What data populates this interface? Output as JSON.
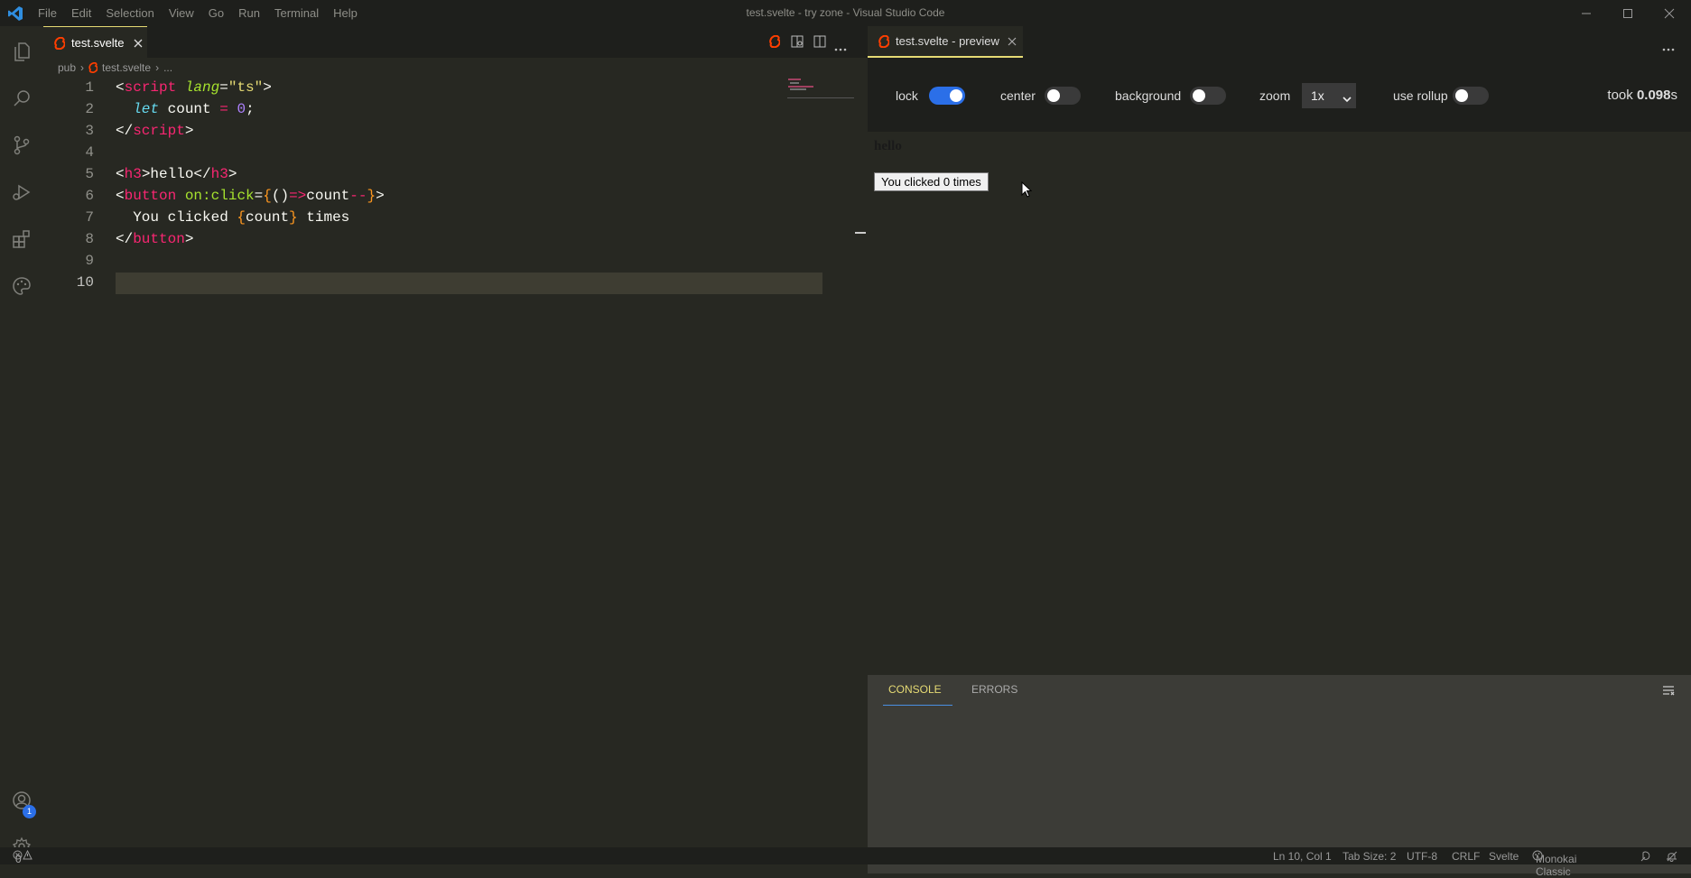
{
  "window": {
    "title": "test.svelte - try zone - Visual Studio Code"
  },
  "menu": [
    "File",
    "Edit",
    "Selection",
    "View",
    "Go",
    "Run",
    "Terminal",
    "Help"
  ],
  "editor": {
    "tab_label": "test.svelte",
    "breadcrumb": {
      "folder": "pub",
      "file": "test.svelte",
      "more": "..."
    },
    "line_numbers": [
      "1",
      "2",
      "3",
      "4",
      "5",
      "6",
      "7",
      "8",
      "9",
      "10"
    ],
    "code": {
      "l1": {
        "a": "<",
        "b": "script",
        "c": " ",
        "d": "lang",
        "e": "=",
        "f": "\"ts\"",
        "g": ">"
      },
      "l2": {
        "a": "  ",
        "b": "let",
        "c": " count ",
        "d": "=",
        "e": " ",
        "f": "0",
        "g": ";"
      },
      "l3": {
        "a": "</",
        "b": "script",
        "c": ">"
      },
      "l5": {
        "a": "<",
        "b": "h3",
        "c": ">hello</",
        "d": "h3",
        "e": ">"
      },
      "l6": {
        "a": "<",
        "b": "button",
        "c": " ",
        "d": "on:click",
        "e": "=",
        "f": "{",
        "g": "()",
        "h": "=>",
        "i": "count",
        "j": "--",
        "k": "}",
        "l": ">"
      },
      "l7": {
        "a": "  You clicked ",
        "b": "{",
        "c": "count",
        "d": "}",
        "e": " times"
      },
      "l8": {
        "a": "</",
        "b": "button",
        "c": ">"
      }
    }
  },
  "preview": {
    "tab_label": "test.svelte - preview",
    "toolbar": {
      "lock": "lock",
      "center": "center",
      "background": "background",
      "zoom": "zoom",
      "zoom_value": "1x",
      "use_rollup": "use rollup",
      "took_prefix": "took ",
      "took_value": "0.098",
      "took_unit": "s"
    },
    "toggles": {
      "lock": true,
      "center": false,
      "background": false,
      "use_rollup": false
    },
    "content": {
      "heading": "hello",
      "button": "You clicked 0 times"
    },
    "panel_tabs": [
      "CONSOLE",
      "ERRORS"
    ]
  },
  "status": {
    "errors": "0",
    "warnings": "0",
    "position": "Ln 10, Col 1",
    "tab_size": "Tab Size: 2",
    "encoding": "UTF-8",
    "eol": "CRLF",
    "language": "Svelte",
    "theme": "Monokai Classic"
  },
  "badges": {
    "accounts": "1"
  },
  "colors": {
    "accent": "#2b6fe8",
    "svelte": "#ff3e00",
    "tab_active_border": "#e6db74"
  }
}
